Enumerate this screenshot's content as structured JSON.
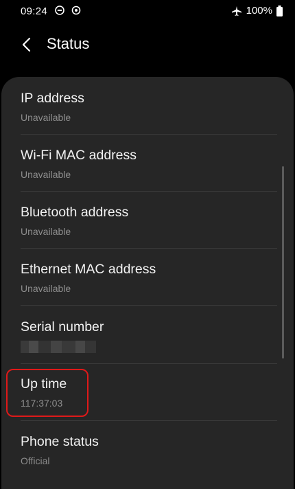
{
  "status_bar": {
    "time": "09:24",
    "battery": "100%",
    "icons": [
      "do-not-disturb-icon",
      "sync-icon",
      "airplane-icon",
      "battery-icon"
    ]
  },
  "header": {
    "back_icon": "back-arrow-icon",
    "title": "Status"
  },
  "items": [
    {
      "label": "IP address",
      "value": "Unavailable"
    },
    {
      "label": "Wi-Fi MAC address",
      "value": "Unavailable"
    },
    {
      "label": "Bluetooth address",
      "value": "Unavailable"
    },
    {
      "label": "Ethernet MAC address",
      "value": "Unavailable"
    },
    {
      "label": "Serial number",
      "value": ""
    },
    {
      "label": "Up time",
      "value": "117:37:03"
    },
    {
      "label": "Phone status",
      "value": "Official"
    }
  ],
  "colors": {
    "background": "#000000",
    "card": "#262626",
    "secondary_text": "#8d8d8d",
    "highlight": "#e01919"
  }
}
